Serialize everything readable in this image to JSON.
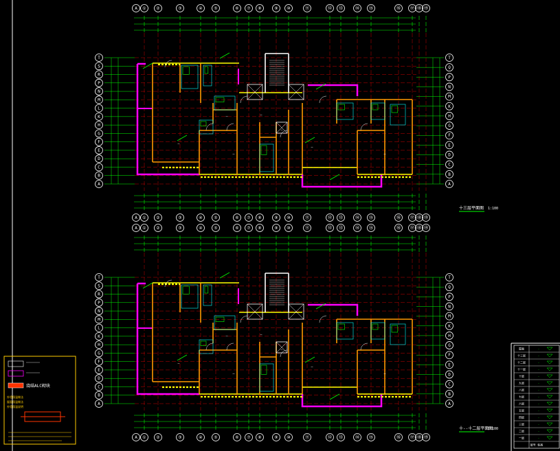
{
  "colors": {
    "background": "#000000",
    "frame": "#ffffff",
    "axis": "#ffffff",
    "dim": "#00ff00",
    "grid": "#ff0000",
    "wall": "#ffff00",
    "wall_orange": "#ff9900",
    "magenta": "#ff00ff",
    "cyan": "#00ffff",
    "white": "#ffffff",
    "legend_border": "#ffcc00",
    "legend_sample": "#ff3300"
  },
  "axes": {
    "top_numbers": [
      "①",
      "②",
      "③",
      "④",
      "⑤",
      "⑥",
      "⑦",
      "⑧",
      "⑨",
      "⑩",
      "⑪",
      "⑫",
      "⑬",
      "⑭",
      "⑮",
      "⑯",
      "⑰",
      "⑱",
      "⑲"
    ],
    "rows_left": [
      "T",
      "S",
      "R",
      "P",
      "N",
      "M",
      "L",
      "K",
      "H",
      "G",
      "F",
      "E",
      "D",
      "C",
      "B",
      "A"
    ],
    "rows_right": [
      "T",
      "Q",
      "P",
      "N",
      "M",
      "K",
      "H",
      "G",
      "F",
      "E",
      "D",
      "C",
      "B",
      "A"
    ]
  },
  "plans": [
    {
      "title": "十三层平面图",
      "scale": "1:100"
    },
    {
      "title": "十--十二层平面图",
      "scale": "1:100"
    }
  ],
  "legend": {
    "sample_label": "烧结ALC砌块",
    "note_lines": [
      "外墙保温做法",
      "屋面保温做法",
      "外墙保温说明"
    ]
  },
  "elev_table": {
    "rows": [
      {
        "floor": "屋面",
        "elev": "-"
      },
      {
        "floor": "十三层",
        "elev": "-"
      },
      {
        "floor": "十二层",
        "elev": "-"
      },
      {
        "floor": "十一层",
        "elev": "-"
      },
      {
        "floor": "十层",
        "elev": "-"
      },
      {
        "floor": "九层",
        "elev": "-"
      },
      {
        "floor": "八层",
        "elev": "-"
      },
      {
        "floor": "七层",
        "elev": "-"
      },
      {
        "floor": "六层",
        "elev": "-"
      },
      {
        "floor": "五层",
        "elev": "-"
      },
      {
        "floor": "四层",
        "elev": "-"
      },
      {
        "floor": "三层",
        "elev": "-"
      },
      {
        "floor": "二层",
        "elev": "-"
      },
      {
        "floor": "一层",
        "elev": "-"
      }
    ],
    "footer": "层号 标高"
  }
}
